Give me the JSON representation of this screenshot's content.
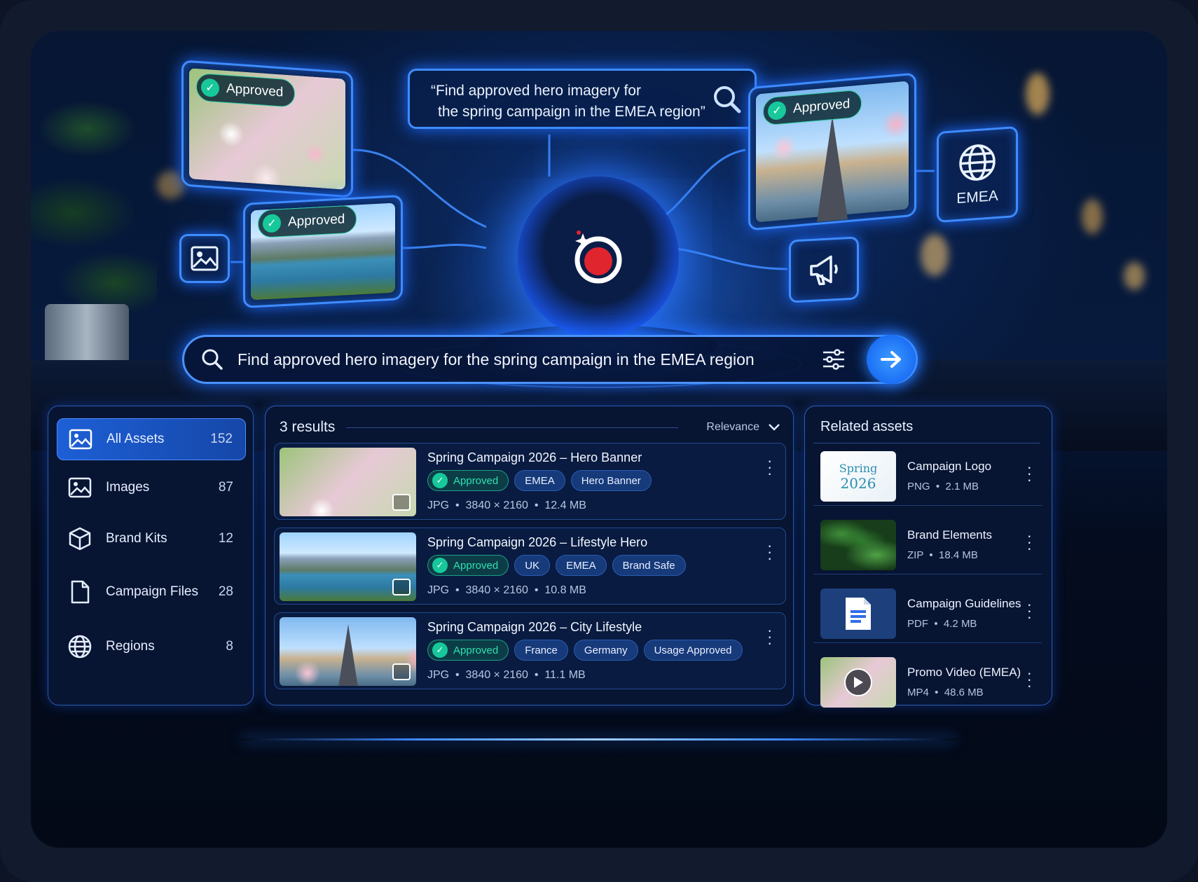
{
  "query_bubble": {
    "line1": "“Find approved hero imagery for",
    "line2": "the spring campaign in the EMEA region”"
  },
  "holo": {
    "approved_label": "Approved",
    "emea_label": "EMEA"
  },
  "search": {
    "value": "Find approved hero imagery for the spring campaign in the EMEA region"
  },
  "sidebar": {
    "items": [
      {
        "label": "All Assets",
        "count": "152",
        "icon": "image-icon"
      },
      {
        "label": "Images",
        "count": "87",
        "icon": "image-icon"
      },
      {
        "label": "Brand Kits",
        "count": "12",
        "icon": "cube-icon"
      },
      {
        "label": "Campaign Files",
        "count": "28",
        "icon": "file-icon"
      },
      {
        "label": "Regions",
        "count": "8",
        "icon": "globe-icon"
      }
    ]
  },
  "results": {
    "count_label": "3 results",
    "sort_label": "Relevance",
    "items": [
      {
        "title": "Spring Campaign 2026 – Hero Banner",
        "tags": [
          "Approved",
          "EMEA",
          "Hero Banner"
        ],
        "format": "JPG",
        "dims": "3840 × 2160",
        "size": "12.4 MB"
      },
      {
        "title": "Spring Campaign 2026 – Lifestyle Hero",
        "tags": [
          "Approved",
          "UK",
          "EMEA",
          "Brand Safe"
        ],
        "format": "JPG",
        "dims": "3840 × 2160",
        "size": "10.8 MB"
      },
      {
        "title": "Spring Campaign 2026 – City Lifestyle",
        "tags": [
          "Approved",
          "France",
          "Germany",
          "Usage Approved"
        ],
        "format": "JPG",
        "dims": "3840 × 2160",
        "size": "11.1 MB"
      }
    ]
  },
  "related": {
    "title": "Related assets",
    "items": [
      {
        "name": "Campaign Logo",
        "format": "PNG",
        "size": "2.1 MB",
        "thumb_line1": "Spring",
        "thumb_line2": "2026"
      },
      {
        "name": "Brand Elements",
        "format": "ZIP",
        "size": "18.4 MB"
      },
      {
        "name": "Campaign Guidelines",
        "format": "PDF",
        "size": "4.2 MB"
      },
      {
        "name": "Promo Video (EMEA)",
        "format": "MP4",
        "size": "48.6 MB"
      }
    ]
  },
  "colors": {
    "accent": "#3f8cff",
    "approved": "#17c89b",
    "panel": "#081634"
  }
}
